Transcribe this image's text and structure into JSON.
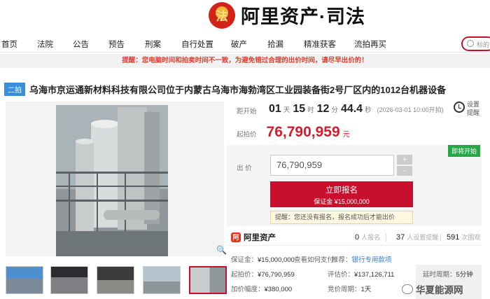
{
  "brand": {
    "emblem_glyph": "法",
    "name": "阿里资产·司法"
  },
  "nav": {
    "items": [
      "首页",
      "法院",
      "公告",
      "预告",
      "刑案",
      "自行处置",
      "破产",
      "拾漏",
      "精准获客",
      "流拍再买"
    ],
    "search_placeholder": "标的"
  },
  "notice": "提醒：您电脑时间和拍卖时间不一致，为避免错过合理的出价时间，请尽早出价的！",
  "lot": {
    "round_badge": "二拍",
    "title": "乌海市京运通新材料科技有限公司位于内蒙古乌海市海勃湾区工业园装备街2号厂区内的1012台机器设备"
  },
  "countdown": {
    "label": "距开始",
    "days": "01",
    "days_unit": "天",
    "hours": "15",
    "hours_unit": "时",
    "minutes": "12",
    "minutes_unit": "分",
    "seconds": "44.4",
    "seconds_unit": "秒",
    "start_text": "(2026-03-01 10:00开拍)"
  },
  "reminder_label": "设置提醒",
  "start_price": {
    "label": "起拍价",
    "value": "76,790,959",
    "unit": "元"
  },
  "bid": {
    "now_tag": "即将开始",
    "label": "出 价",
    "input_value": "76,790,959",
    "plus": "+",
    "minus": "-",
    "signup_label": "立即报名",
    "deposit_line": "保证金 ¥15,000,000",
    "tip": "提醒：您还没有报名，报名成功后才能出价"
  },
  "stats": {
    "platform_mark": "阿",
    "platform": "阿里资产",
    "signups": "0",
    "signups_label": "人报名",
    "reminders": "37",
    "reminders_label": "人设置提醒",
    "views": "591",
    "views_label": "次围观"
  },
  "details": {
    "deposit_label": "保证金：",
    "deposit_value": "¥15,000,000",
    "how_to_pay": "查看如何支付",
    "recommend_label": "推荐：",
    "recommend_value": "银行专用款项",
    "start_label": "起拍价：",
    "start_value": "¥76,790,959",
    "appraisal_label": "评估价：",
    "appraisal_value": "¥137,126,711",
    "delay_label": "延时周期：",
    "delay_value": "5分钟",
    "increment_label": "加价幅度：",
    "increment_value": "¥380,000",
    "cycle_label": "竞价周期：",
    "cycle_value": "1天"
  },
  "watermark": "华夏能源网",
  "colors": {
    "brand_red": "#c8102e",
    "price_red": "#d31d2f",
    "badge_blue": "#3b8fd8",
    "tag_green": "#28a745"
  }
}
